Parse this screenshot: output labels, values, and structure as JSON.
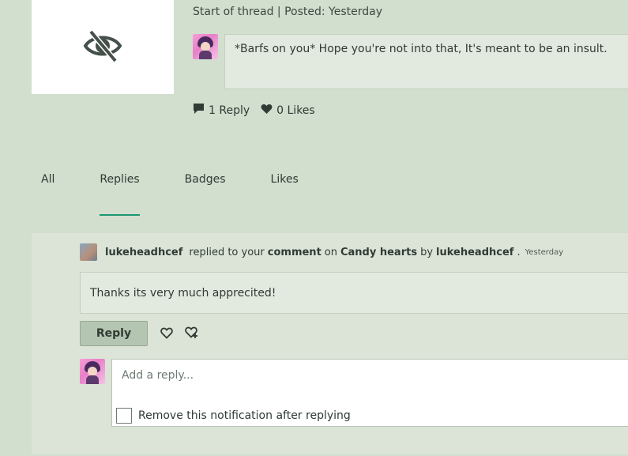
{
  "thread": {
    "meta": "Start of thread | Posted: Yesterday",
    "message": "*Barfs on you* Hope you're not into that, It's meant to be an insult.",
    "thumbnail_icon": "eye-slash-icon",
    "replies": "1 Reply",
    "likes": "0 Likes"
  },
  "tabs": [
    {
      "label": "All"
    },
    {
      "label": "Replies",
      "active": true
    },
    {
      "label": "Badges"
    },
    {
      "label": "Likes"
    }
  ],
  "notification": {
    "user": "lukeheadhcef",
    "action": "replied to your",
    "target": "comment",
    "on": "on",
    "post": "Candy hearts",
    "by": "by",
    "author": "lukeheadhcef",
    "separator": ".",
    "time": "Yesterday",
    "reply_text": "Thanks its very much apprecited!",
    "reply_button": "Reply",
    "compose_placeholder": "Add a reply...",
    "remove_label": "Remove this notification after replying"
  },
  "colors": {
    "background": "#d2dece",
    "panel": "#dbe4d7",
    "accent": "#1a9670",
    "button": "#b4c5b1"
  }
}
